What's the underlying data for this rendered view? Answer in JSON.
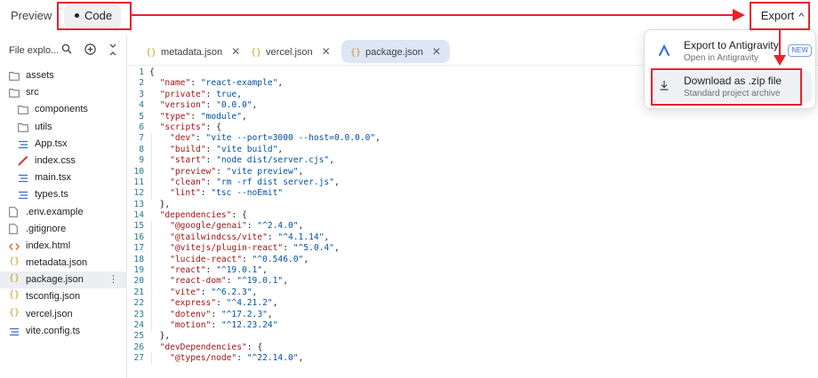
{
  "topbar": {
    "preview_label": "Preview",
    "code_label": "Code",
    "export_label": "Export"
  },
  "sidebar": {
    "title": "File explo...",
    "icons": [
      "search-icon",
      "add-icon",
      "collapse-icon"
    ],
    "items": [
      {
        "label": "assets",
        "icon": "folder-icon",
        "depth": 0
      },
      {
        "label": "src",
        "icon": "folder-icon",
        "depth": 0
      },
      {
        "label": "components",
        "icon": "folder-icon",
        "depth": 1
      },
      {
        "label": "utils",
        "icon": "folder-icon",
        "depth": 1
      },
      {
        "label": "App.tsx",
        "icon": "lines-icon",
        "depth": 1
      },
      {
        "label": "index.css",
        "icon": "pencil-icon",
        "depth": 1
      },
      {
        "label": "main.tsx",
        "icon": "lines-icon",
        "depth": 1
      },
      {
        "label": "types.ts",
        "icon": "lines-icon",
        "depth": 1
      },
      {
        "label": ".env.example",
        "icon": "file-icon",
        "depth": 0
      },
      {
        "label": ".gitignore",
        "icon": "file-icon",
        "depth": 0
      },
      {
        "label": "index.html",
        "icon": "code-icon",
        "depth": 0
      },
      {
        "label": "metadata.json",
        "icon": "braces-icon",
        "depth": 0
      },
      {
        "label": "package.json",
        "icon": "braces-icon",
        "depth": 0,
        "selected": true
      },
      {
        "label": "tsconfig.json",
        "icon": "braces-icon",
        "depth": 0
      },
      {
        "label": "vercel.json",
        "icon": "braces-icon",
        "depth": 0
      },
      {
        "label": "vite.config.ts",
        "icon": "lines-icon",
        "depth": 0
      }
    ]
  },
  "tabs": [
    {
      "label": "metadata.json",
      "close": "✕"
    },
    {
      "label": "vercel.json",
      "close": "✕"
    },
    {
      "label": "package.json",
      "close": "✕",
      "active": true
    }
  ],
  "code": [
    {
      "n": "1",
      "text": "{"
    },
    {
      "n": "2",
      "text": "  \"name\": \"react-example\","
    },
    {
      "n": "3",
      "text": "  \"private\": true,"
    },
    {
      "n": "4",
      "text": "  \"version\": \"0.0.0\","
    },
    {
      "n": "5",
      "text": "  \"type\": \"module\","
    },
    {
      "n": "6",
      "text": "  \"scripts\": {"
    },
    {
      "n": "7",
      "text": "    \"dev\": \"vite --port=3000 --host=0.0.0.0\","
    },
    {
      "n": "8",
      "text": "    \"build\": \"vite build\","
    },
    {
      "n": "9",
      "text": "    \"start\": \"node dist/server.cjs\","
    },
    {
      "n": "10",
      "text": "    \"preview\": \"vite preview\","
    },
    {
      "n": "11",
      "text": "    \"clean\": \"rm -rf dist server.js\","
    },
    {
      "n": "12",
      "text": "    \"lint\": \"tsc --noEmit\""
    },
    {
      "n": "13",
      "text": "  },"
    },
    {
      "n": "14",
      "text": "  \"dependencies\": {"
    },
    {
      "n": "15",
      "text": "    \"@google/genai\": \"^2.4.0\","
    },
    {
      "n": "16",
      "text": "    \"@tailwindcss/vite\": \"^4.1.14\","
    },
    {
      "n": "17",
      "text": "    \"@vitejs/plugin-react\": \"^5.0.4\","
    },
    {
      "n": "18",
      "text": "    \"lucide-react\": \"^0.546.0\","
    },
    {
      "n": "19",
      "text": "    \"react\": \"^19.0.1\","
    },
    {
      "n": "20",
      "text": "    \"react-dom\": \"^19.0.1\","
    },
    {
      "n": "21",
      "text": "    \"vite\": \"^6.2.3\","
    },
    {
      "n": "22",
      "text": "    \"express\": \"^4.21.2\","
    },
    {
      "n": "23",
      "text": "    \"dotenv\": \"^17.2.3\","
    },
    {
      "n": "24",
      "text": "    \"motion\": \"^12.23.24\""
    },
    {
      "n": "25",
      "text": "  },"
    },
    {
      "n": "26",
      "text": "  \"devDependencies\": {"
    },
    {
      "n": "27",
      "text": "    \"@types/node\": \"^22.14.0\","
    }
  ],
  "dropdown": {
    "items": [
      {
        "title": "Export to Antigravity",
        "subtitle": "Open in Antigravity",
        "badge": "NEW",
        "icon": "antigravity-icon"
      },
      {
        "title": "Download as .zip file",
        "subtitle": "Standard project archive",
        "icon": "download-icon"
      }
    ]
  },
  "colors": {
    "annotation": "#e8222b",
    "active_tab": "#dde6f5",
    "json_key": "#a31515",
    "json_value": "#0451a5",
    "line_number": "#237893"
  }
}
